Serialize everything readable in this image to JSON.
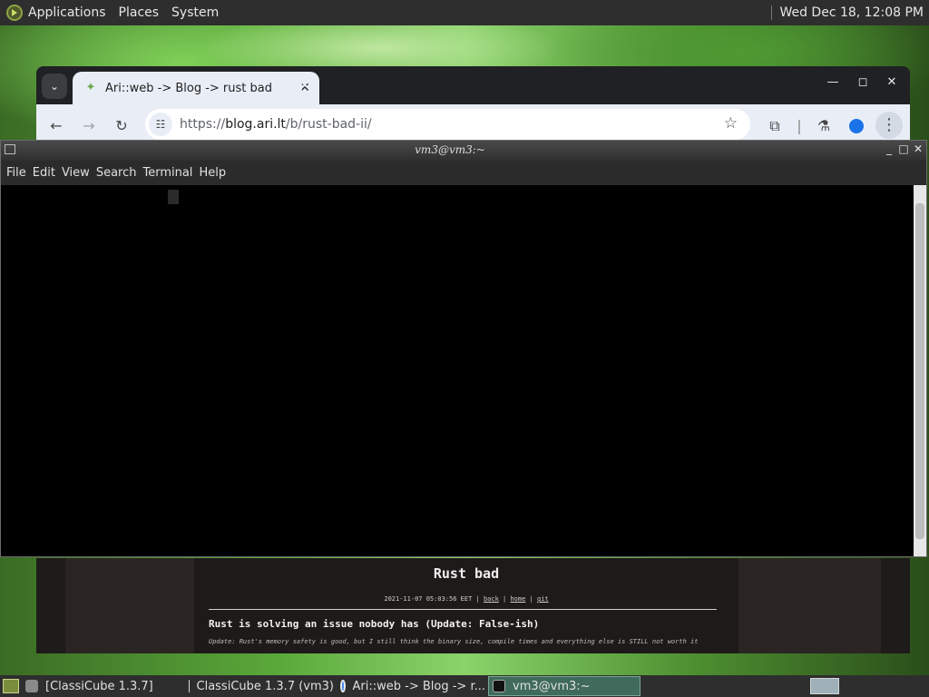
{
  "top_panel": {
    "menus": [
      "Applications",
      "Places",
      "System"
    ],
    "clock": "Wed Dec 18, 12:08 PM"
  },
  "browser": {
    "tab_title": "Ari::web -> Blog -> rust bad",
    "url_scheme": "https://",
    "url_host": "blog.ari.lt",
    "url_path": "/b/rust-bad-ii/"
  },
  "blog": {
    "title": "Rust bad",
    "meta_date": "2021-11-07 05:03:56 EET | ",
    "meta_links": [
      "back",
      "home",
      "git"
    ],
    "heading": "Rust is solving an issue nobody has (Update: False-ish)",
    "update_text": "Update: Rust's memory safety is good, but I still think the binary size, compile times and everything else is STILL not worth it"
  },
  "terminal": {
    "title": "vm3@vm3:~",
    "menus": [
      "File",
      "Edit",
      "View",
      "Search",
      "Terminal",
      "Help"
    ]
  },
  "taskbar": {
    "items": [
      {
        "label": "[ClassiCube 1.3.7]",
        "icon": "window-icon",
        "active": false
      },
      {
        "label": "ClassiCube 1.3.7 (vm3)",
        "icon": "cube-icon",
        "active": false
      },
      {
        "label": "Ari::web -> Blog -> r...",
        "icon": "chrome-icon",
        "active": false
      },
      {
        "label": "vm3@vm3:~",
        "icon": "terminal-icon",
        "active": true
      }
    ]
  }
}
